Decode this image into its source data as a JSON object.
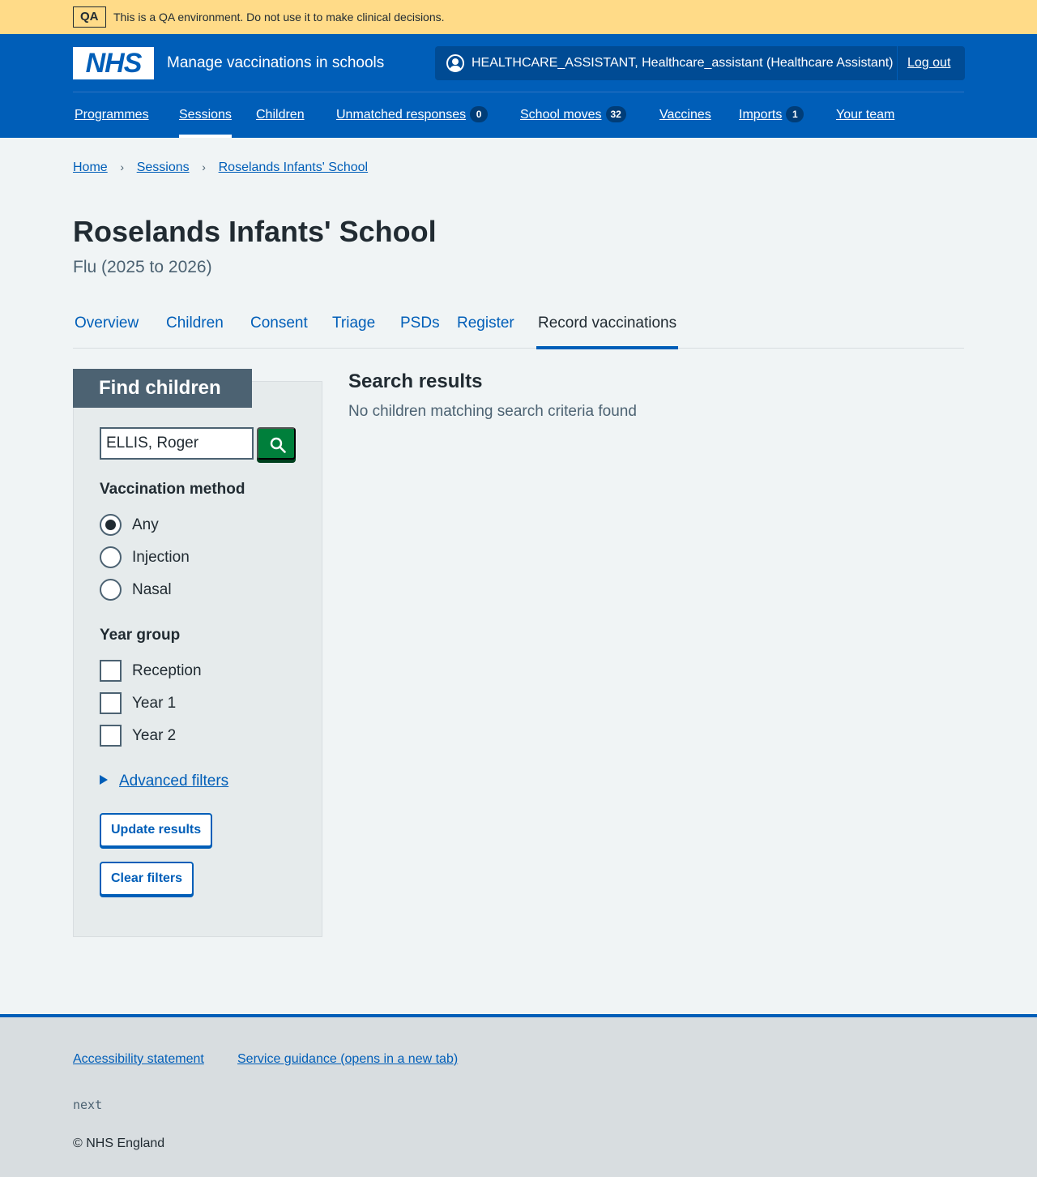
{
  "qa_banner": {
    "tag": "QA",
    "text": "This is a QA environment. Do not use it to make clinical decisions."
  },
  "header": {
    "logo_text": "NHS",
    "service_name": "Manage vaccinations in schools",
    "account_name": "HEALTHCARE_ASSISTANT, Healthcare_assistant (Healthcare Assistant)",
    "logout_label": "Log out",
    "account_icon": "user-circle-icon"
  },
  "nav": {
    "items": [
      {
        "label": "Programmes"
      },
      {
        "label": "Sessions",
        "active": true
      },
      {
        "label": "Children"
      },
      {
        "label": "Unmatched responses",
        "count": "0"
      },
      {
        "label": "School moves",
        "count": "32"
      },
      {
        "label": "Vaccines"
      },
      {
        "label": "Imports",
        "count": "1"
      },
      {
        "label": "Your team"
      }
    ]
  },
  "breadcrumb": {
    "items": [
      {
        "label": "Home"
      },
      {
        "label": "Sessions"
      },
      {
        "label": "Roselands Infants' School"
      }
    ],
    "separator": "›"
  },
  "page": {
    "title": "Roselands Infants' School",
    "caption": "Flu (2025 to 2026)"
  },
  "tabs": {
    "items": [
      {
        "label": "Overview"
      },
      {
        "label": "Children"
      },
      {
        "label": "Consent"
      },
      {
        "label": "Triage"
      },
      {
        "label": "PSDs"
      },
      {
        "label": "Register"
      },
      {
        "label": "Record vaccinations",
        "active": true
      }
    ]
  },
  "filters": {
    "heading": "Find children",
    "search_value": "ELLIS, Roger",
    "search_icon": "search-icon",
    "vaccination_method": {
      "legend": "Vaccination method",
      "options": [
        "Any",
        "Injection",
        "Nasal"
      ],
      "selected": "Any"
    },
    "year_group": {
      "legend": "Year group",
      "options": [
        "Reception",
        "Year 1",
        "Year 2"
      ]
    },
    "advanced_label": "Advanced filters",
    "update_label": "Update results",
    "clear_label": "Clear filters"
  },
  "results": {
    "title": "Search results",
    "empty_text": "No children matching search criteria found"
  },
  "footer": {
    "links": [
      "Accessibility statement",
      "Service guidance (opens in a new tab)"
    ],
    "environment": "next",
    "copyright": "© NHS England"
  },
  "colors": {
    "nhs_blue": "#005eb8",
    "qa_banner": "#ffdb88",
    "search_button": "#007f3b",
    "filter_heading": "#4c6272"
  }
}
